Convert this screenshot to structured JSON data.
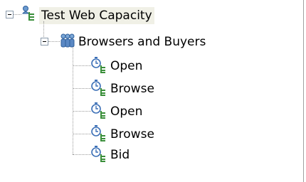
{
  "tree": {
    "root": {
      "label": "Test Web Capacity",
      "icon": "test-schedule-icon",
      "expanded": true,
      "selected": true
    },
    "group": {
      "label": "Browsers and Buyers",
      "icon": "user-group-icon",
      "expanded": true
    },
    "tests": [
      {
        "label": "Open",
        "icon": "test-timer-icon"
      },
      {
        "label": "Browse",
        "icon": "test-timer-icon"
      },
      {
        "label": "Open",
        "icon": "test-timer-icon"
      },
      {
        "label": "Browse",
        "icon": "test-timer-icon"
      },
      {
        "label": "Bid",
        "icon": "test-timer-icon"
      }
    ]
  },
  "colors": {
    "icon_green": "#3a8f3a",
    "icon_blue": "#3b6fb6",
    "selection_bg": "#f0f0e6",
    "tree_line": "#9a9a9a"
  }
}
